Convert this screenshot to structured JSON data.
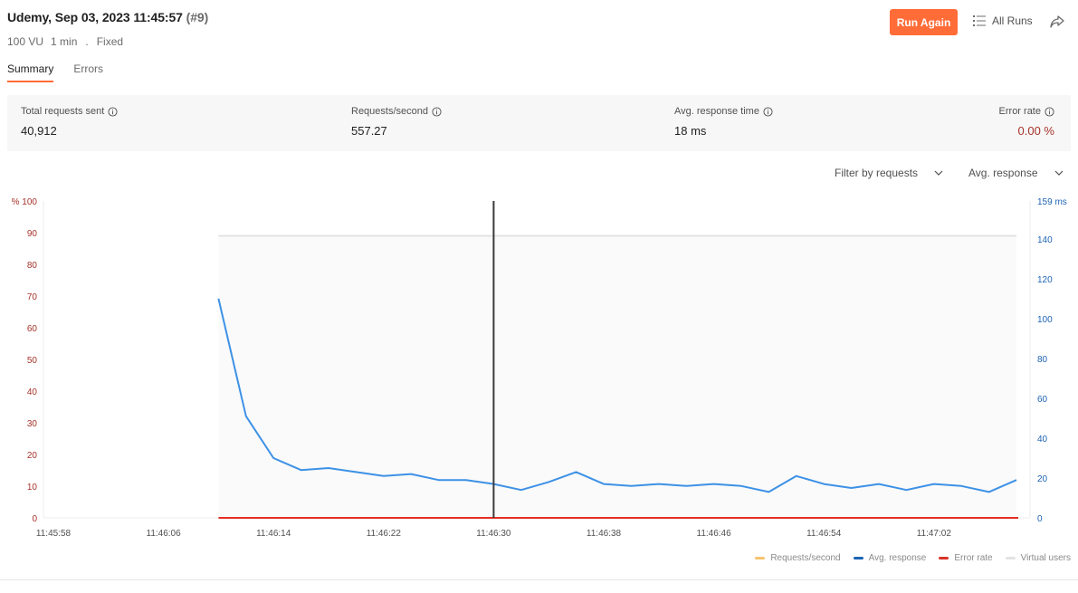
{
  "header": {
    "title": "Udemy, Sep 03, 2023 11:45:57",
    "run_number": "(#9)",
    "virtual_users": "100 VU",
    "duration": "1 min",
    "separator": ".",
    "load_profile": "Fixed",
    "run_again_label": "Run Again",
    "all_runs_label": "All Runs"
  },
  "tabs": [
    {
      "label": "Summary",
      "active": true
    },
    {
      "label": "Errors",
      "active": false
    }
  ],
  "metrics": [
    {
      "label": "Total requests sent",
      "value": "40,912"
    },
    {
      "label": "Requests/second",
      "value": "557.27"
    },
    {
      "label": "Avg. response time",
      "value": "18 ms"
    },
    {
      "label": "Error rate",
      "value": "0.00 %"
    }
  ],
  "filters": {
    "requests_filter": "Filter by requests",
    "metric_select": "Avg. response"
  },
  "colors": {
    "accent": "#ff6c37",
    "error_axis": "#a6332a",
    "response_axis": "#1d63b5",
    "avg_response_line": "#3d91e6",
    "error_rate_line": "#e52f24",
    "virtual_users_line": "#e3e3e3",
    "requests_per_second": "#f5c36f"
  },
  "chart_data": {
    "type": "line",
    "x_labels": [
      "11:45:58",
      "11:46:06",
      "11:46:14",
      "11:46:22",
      "11:46:30",
      "11:46:38",
      "11:46:46",
      "11:46:54",
      "11:47:02"
    ],
    "left_axis": {
      "unit_label": "%",
      "max_label": "100",
      "ticks": [
        0,
        10,
        20,
        30,
        40,
        50,
        60,
        70,
        80,
        90,
        100
      ]
    },
    "right_axis": {
      "max_label": "159 ms",
      "max": 159,
      "ticks": [
        0,
        20,
        40,
        60,
        80,
        100,
        120,
        140
      ]
    },
    "series": [
      {
        "name": "Avg. response",
        "axis": "right",
        "x": [
          "11:46:10",
          "11:46:12",
          "11:46:14",
          "11:46:16",
          "11:46:18",
          "11:46:20",
          "11:46:22",
          "11:46:24",
          "11:46:26",
          "11:46:28",
          "11:46:30",
          "11:46:32",
          "11:46:34",
          "11:46:36",
          "11:46:38",
          "11:46:40",
          "11:46:42",
          "11:46:44",
          "11:46:46",
          "11:46:48",
          "11:46:50",
          "11:46:52",
          "11:46:54",
          "11:46:56",
          "11:46:58",
          "11:47:00",
          "11:47:02",
          "11:47:04",
          "11:47:06",
          "11:47:08"
        ],
        "values": [
          110,
          51,
          30,
          24,
          25,
          23,
          21,
          22,
          19,
          19,
          17,
          14,
          18,
          23,
          17,
          16,
          17,
          16,
          17,
          16,
          13,
          21,
          17,
          15,
          17,
          14,
          17,
          16,
          13,
          19
        ]
      },
      {
        "name": "Error rate",
        "axis": "left",
        "x": [
          "11:46:10",
          "11:47:08"
        ],
        "values": [
          0,
          0
        ]
      },
      {
        "name": "Virtual users",
        "axis": "left",
        "x": [
          "11:46:10",
          "11:47:08"
        ],
        "values": [
          89,
          89
        ]
      },
      {
        "name": "Requests/second",
        "axis": "left",
        "x": [],
        "values": []
      }
    ],
    "cursor_x": "11:46:30",
    "legend": [
      "Requests/second",
      "Avg. response",
      "Error rate",
      "Virtual users"
    ],
    "legend_position": "bottom-right"
  }
}
